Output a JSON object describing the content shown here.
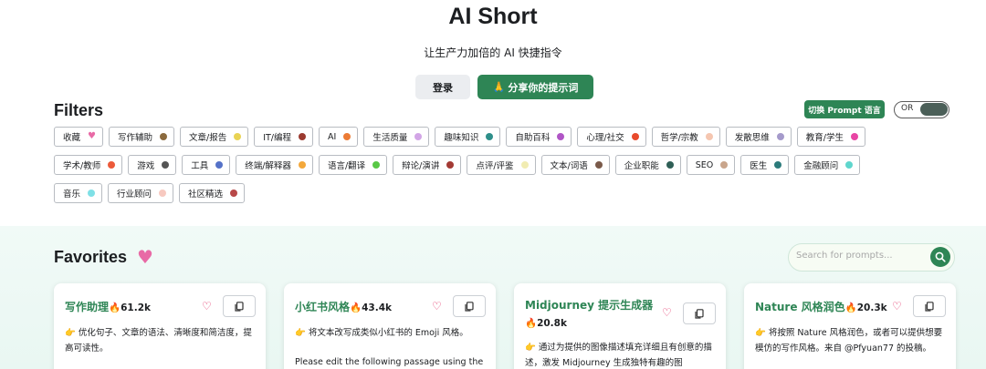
{
  "app": {
    "title": "AI Short",
    "subtitle": "让生产力加倍的 AI 快捷指令",
    "login_label": "登录",
    "share_icon": "🙏",
    "share_label": "分享你的提示词"
  },
  "filters": {
    "title": "Filters",
    "language_button": "切换 Prompt 语言",
    "toggle_label": "OR",
    "rows": [
      [
        {
          "label": "收藏",
          "color": "#e86aa6",
          "icon": "heart-icon"
        },
        {
          "label": "写作辅助",
          "color": "#8b6a3e"
        },
        {
          "label": "文章/报告",
          "color": "#e9d354"
        },
        {
          "label": "IT/编程",
          "color": "#9b3a30"
        },
        {
          "label": "AI",
          "color": "#ec7b35"
        },
        {
          "label": "生活质量",
          "color": "#d2a5e6"
        },
        {
          "label": "趣味知识",
          "color": "#2e8f8a"
        },
        {
          "label": "自助百科",
          "color": "#b055c6"
        },
        {
          "label": "心理/社交",
          "color": "#e84a2c"
        },
        {
          "label": "哲学/宗教",
          "color": "#f5c6b0"
        },
        {
          "label": "发散思维",
          "color": "#a59acb"
        },
        {
          "label": "教育/学生",
          "color": "#e845a4"
        }
      ],
      [
        {
          "label": "学术/教师",
          "color": "#ec5a3a"
        },
        {
          "label": "游戏",
          "color": "#555555"
        },
        {
          "label": "工具",
          "color": "#5572c8"
        },
        {
          "label": "终端/解释器",
          "color": "#f3a83b"
        },
        {
          "label": "语言/翻译",
          "color": "#59c846"
        },
        {
          "label": "辩论/演讲",
          "color": "#a33a34"
        },
        {
          "label": "点评/评鉴",
          "color": "#f1ecb2"
        },
        {
          "label": "文本/词语",
          "color": "#7a5a4a"
        },
        {
          "label": "企业职能",
          "color": "#2f5f56"
        },
        {
          "label": "SEO",
          "color": "#c9a58c"
        },
        {
          "label": "医生",
          "color": "#2c7b7b"
        },
        {
          "label": "金融顾问",
          "color": "#5fd6cd"
        }
      ],
      [
        {
          "label": "音乐",
          "color": "#7fe0e6"
        },
        {
          "label": "行业顾问",
          "color": "#f7c9c0"
        },
        {
          "label": "社区精选",
          "color": "#b84848"
        }
      ]
    ]
  },
  "favorites": {
    "title": "Favorites",
    "search_placeholder": "Search for prompts...",
    "cards": [
      {
        "title": "写作助理",
        "count": "🔥61.2k",
        "desc": "👉 优化句子、文章的语法、清晰度和简洁度，提高可读性。"
      },
      {
        "title": "小红书风格",
        "count": "🔥43.4k",
        "desc": "👉 将文本改写成类似小红书的 Emoji 风格。",
        "desc2": "Please edit the following passage using the"
      },
      {
        "title": "Midjourney 提示生成器",
        "count": "🔥20.8k",
        "desc": "👉 通过为提供的图像描述填充详细且有创意的描述，激发 Midjourney 生成独特有趣的图"
      },
      {
        "title": "Nature 风格润色",
        "count": "🔥20.3k",
        "desc": "👉 将按照 Nature 风格润色，或者可以提供想要模仿的写作风格。来自 @Pfyuan77 的投稿。"
      }
    ]
  }
}
